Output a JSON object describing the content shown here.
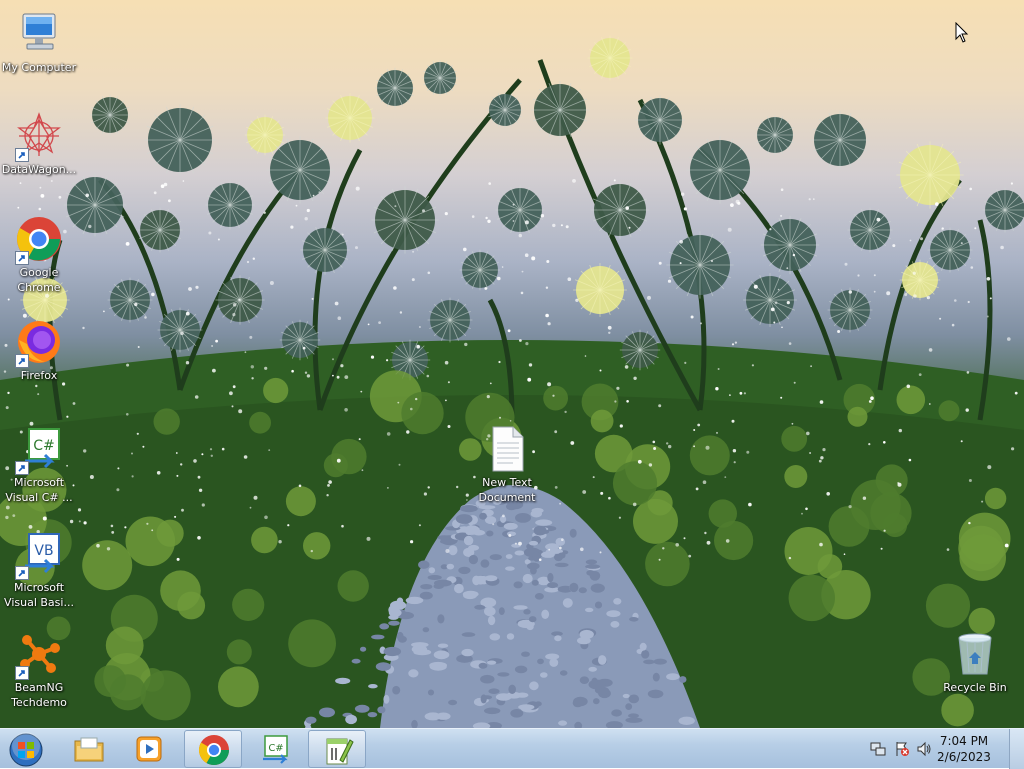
{
  "desktop": {
    "icons": [
      {
        "name": "my-computer-icon",
        "label": "My Computer"
      },
      {
        "name": "datawagon-icon",
        "label": "DataWagon..."
      },
      {
        "name": "google-chrome-icon",
        "label": "Google\nChrome"
      },
      {
        "name": "firefox-icon",
        "label": "Firefox"
      },
      {
        "name": "visual-csharp-icon",
        "label": "Microsoft\nVisual C# ..."
      },
      {
        "name": "visual-basic-icon",
        "label": "Microsoft\nVisual Basi..."
      },
      {
        "name": "beamng-icon",
        "label": "BeamNG\nTechdemo"
      },
      {
        "name": "text-document-icon",
        "label": "New Text\nDocument"
      },
      {
        "name": "recycle-bin-icon",
        "label": "Recycle Bin"
      }
    ]
  },
  "taskbar": {
    "pinned": [
      {
        "name": "windows-explorer-icon"
      },
      {
        "name": "media-player-icon"
      },
      {
        "name": "chrome-icon"
      },
      {
        "name": "visual-csharp-icon"
      },
      {
        "name": "notepad-plus-plus-icon"
      }
    ],
    "clock": {
      "time": "7:04 PM",
      "date": "2/6/2023"
    },
    "tray_icons": [
      "network-icon",
      "action-center-icon",
      "volume-icon"
    ]
  }
}
